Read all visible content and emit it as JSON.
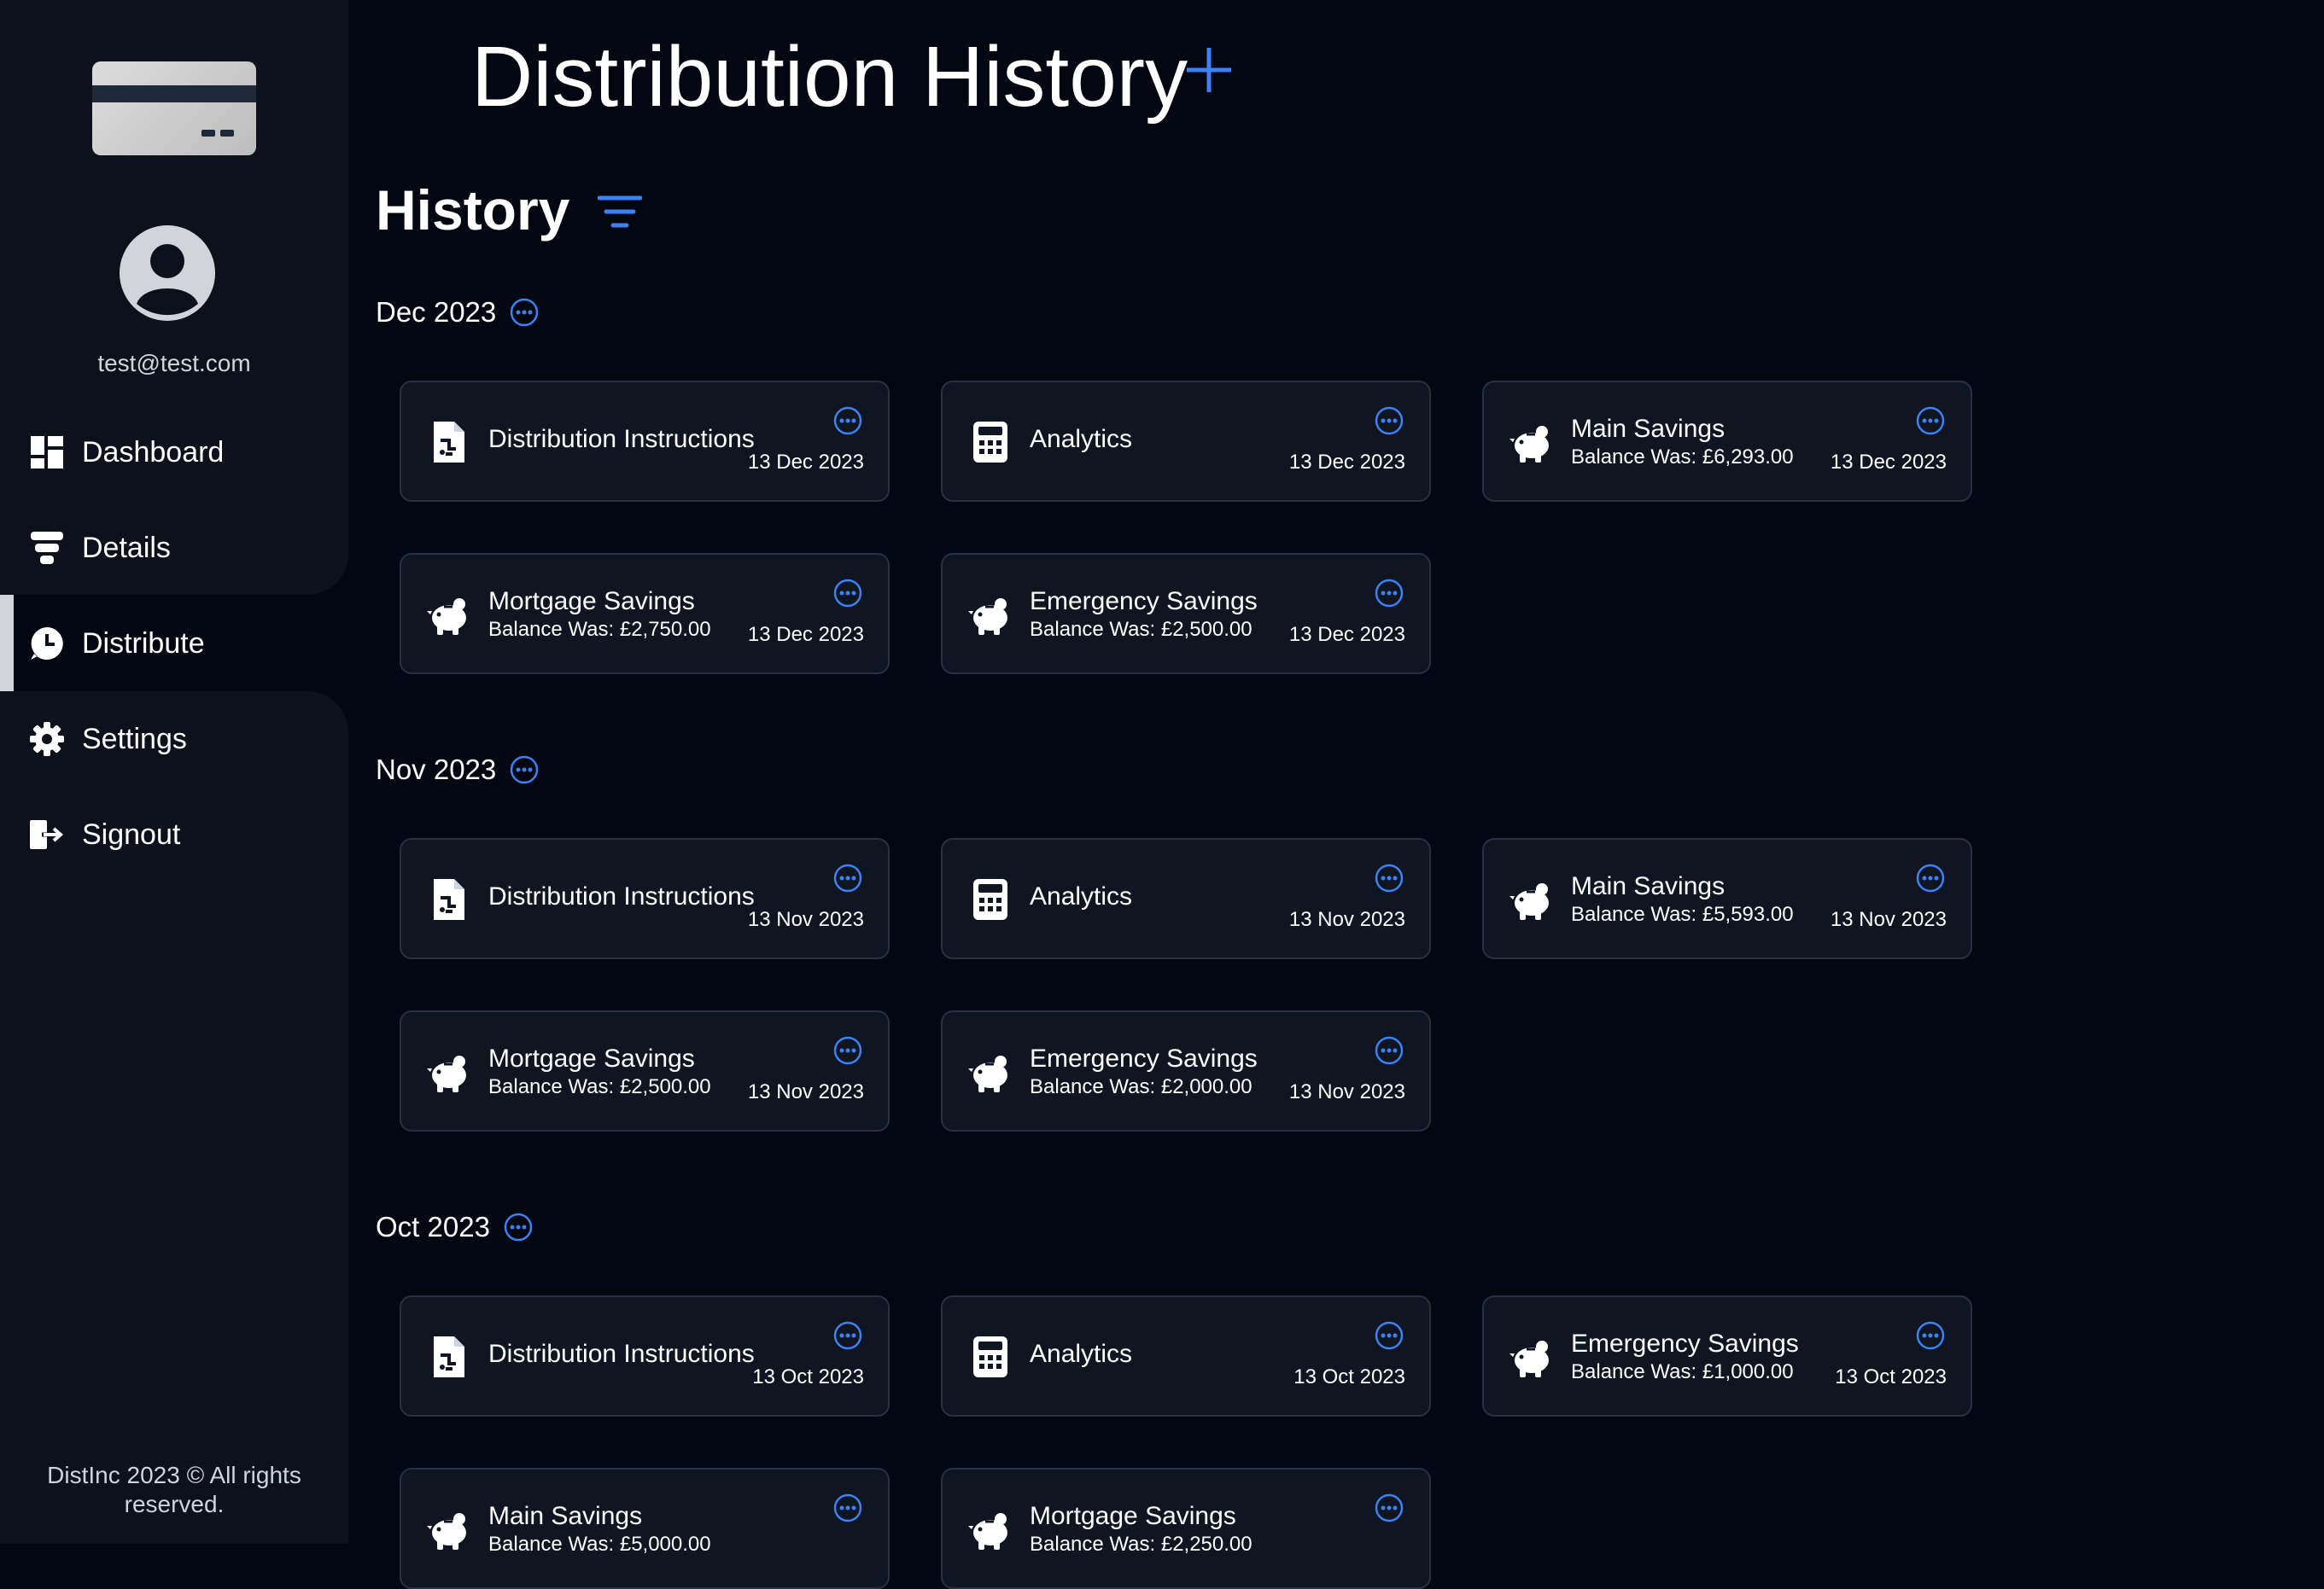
{
  "sidebar": {
    "user_email": "test@test.com",
    "nav": [
      {
        "label": "Dashboard",
        "icon": "dashboard-icon"
      },
      {
        "label": "Details",
        "icon": "details-icon"
      },
      {
        "label": "Distribute",
        "icon": "distribute-icon",
        "active": true
      },
      {
        "label": "Settings",
        "icon": "gear-icon"
      },
      {
        "label": "Signout",
        "icon": "signout-icon"
      }
    ],
    "footer_line1": "DistInc 2023 © All rights",
    "footer_line2": "reserved."
  },
  "header": {
    "title": "Distribution History"
  },
  "history": {
    "title": "History",
    "months": [
      {
        "label": "Dec 2023",
        "items": [
          {
            "type": "distribution",
            "name": "Distribution Instructions",
            "balance": "",
            "date": "13 Dec 2023"
          },
          {
            "type": "analytics",
            "name": "Analytics",
            "balance": "",
            "date": "13 Dec 2023"
          },
          {
            "type": "savings",
            "name": "Main Savings",
            "balance": "Balance Was: £6,293.00",
            "date": "13 Dec 2023"
          },
          {
            "type": "savings",
            "name": "Mortgage Savings",
            "balance": "Balance Was: £2,750.00",
            "date": "13 Dec 2023"
          },
          {
            "type": "savings",
            "name": "Emergency Savings",
            "balance": "Balance Was: £2,500.00",
            "date": "13 Dec 2023"
          }
        ]
      },
      {
        "label": "Nov 2023",
        "items": [
          {
            "type": "distribution",
            "name": "Distribution Instructions",
            "balance": "",
            "date": "13 Nov 2023"
          },
          {
            "type": "analytics",
            "name": "Analytics",
            "balance": "",
            "date": "13 Nov 2023"
          },
          {
            "type": "savings",
            "name": "Main Savings",
            "balance": "Balance Was: £5,593.00",
            "date": "13 Nov 2023"
          },
          {
            "type": "savings",
            "name": "Mortgage Savings",
            "balance": "Balance Was: £2,500.00",
            "date": "13 Nov 2023"
          },
          {
            "type": "savings",
            "name": "Emergency Savings",
            "balance": "Balance Was: £2,000.00",
            "date": "13 Nov 2023"
          }
        ]
      },
      {
        "label": "Oct 2023",
        "items": [
          {
            "type": "distribution",
            "name": "Distribution Instructions",
            "balance": "",
            "date": "13 Oct 2023"
          },
          {
            "type": "analytics",
            "name": "Analytics",
            "balance": "",
            "date": "13 Oct 2023"
          },
          {
            "type": "savings",
            "name": "Emergency Savings",
            "balance": "Balance Was: £1,000.00",
            "date": "13 Oct 2023"
          },
          {
            "type": "savings",
            "name": "Main Savings",
            "balance": "Balance Was: £5,000.00",
            "date": ""
          },
          {
            "type": "savings",
            "name": "Mortgage Savings",
            "balance": "Balance Was: £2,250.00",
            "date": ""
          }
        ]
      }
    ]
  },
  "colors": {
    "background": "#030712",
    "sidebar": "#0c111c",
    "card": "#101522",
    "accent": "#3b82f6"
  }
}
